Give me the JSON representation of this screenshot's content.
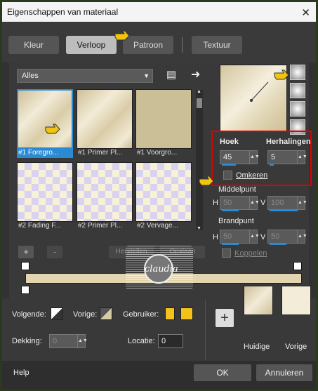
{
  "window": {
    "title": "Eigenschappen van materiaal"
  },
  "tabs": [
    "Kleur",
    "Verloop",
    "Patroon",
    "Textuur"
  ],
  "category": {
    "selected": "Alles"
  },
  "thumbnails": [
    "#1 Foregro...",
    "#1 Primer Pl...",
    "#1 Voorgro...",
    "#2 Fading F...",
    "#2 Primer Pl...",
    "#2 Vervage..."
  ],
  "angle": {
    "label": "Hoek",
    "value": "45"
  },
  "repeats": {
    "label": "Herhalingen",
    "value": "5"
  },
  "invert": {
    "label": "Omkeren"
  },
  "midpoint": {
    "label": "Middelpunt",
    "h_label": "H",
    "h": "50",
    "v_label": "V",
    "v": "100"
  },
  "focal": {
    "label": "Brandpunt",
    "h_label": "H",
    "h": "50",
    "v_label": "V",
    "v": "50"
  },
  "link": {
    "label": "Koppelen"
  },
  "editor": {
    "add": "+",
    "remove": "-",
    "restore": "Herstellen",
    "save": "Opslaan"
  },
  "watermark": "claudia",
  "bottom": {
    "next_label": "Volgende:",
    "prev_label": "Vorige:",
    "user_label": "Gebruiker:",
    "opacity_label": "Dekking:",
    "opacity": "0",
    "location_label": "Locatie:",
    "location": "0",
    "current_label": "Huidige",
    "previous_label": "Vorige",
    "plus": "+"
  },
  "footer": {
    "help": "Help",
    "ok": "OK",
    "cancel": "Annuleren"
  },
  "colors": {
    "accent": "#2a8ad4",
    "highlight": "#e00000",
    "user": "#f3c21b",
    "gold": "#d8cba4"
  }
}
